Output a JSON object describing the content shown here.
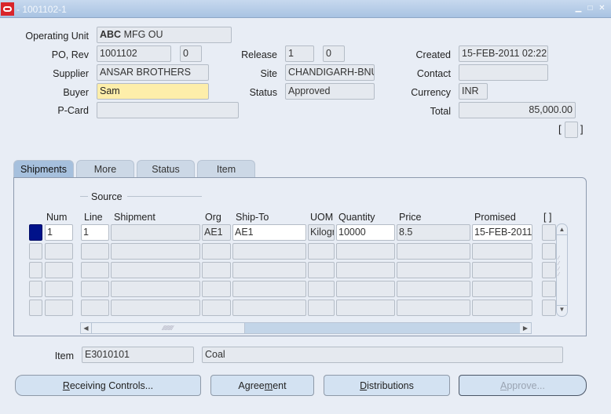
{
  "window": {
    "title": "- 1001102-1",
    "controls": {
      "minimize": "▁",
      "maximize": "□",
      "close": "✕"
    }
  },
  "header": {
    "operating_unit": {
      "label": "Operating Unit",
      "value_bold": "ABC",
      "value_rest": " MFG OU"
    },
    "po_rev": {
      "label": "PO, Rev",
      "po": "1001102",
      "rev": "0"
    },
    "supplier": {
      "label": "Supplier",
      "value": "ANSAR BROTHERS"
    },
    "buyer": {
      "label": "Buyer",
      "value": "Sam"
    },
    "pcard": {
      "label": "P-Card",
      "value": ""
    },
    "release": {
      "label": "Release",
      "num": "1",
      "rev": "0"
    },
    "site": {
      "label": "Site",
      "value": "CHANDIGARH-BNU"
    },
    "status": {
      "label": "Status",
      "value": "Approved"
    },
    "created": {
      "label": "Created",
      "value": "15-FEB-2011 02:22"
    },
    "contact": {
      "label": "Contact",
      "value": ""
    },
    "currency": {
      "label": "Currency",
      "value": "INR"
    },
    "total": {
      "label": "Total",
      "value": "85,000.00"
    },
    "dff": {
      "open": "[",
      "close": "]"
    }
  },
  "tabs": [
    {
      "label": "Shipments",
      "active": true
    },
    {
      "label": "More",
      "active": false
    },
    {
      "label": "Status",
      "active": false
    },
    {
      "label": "Item",
      "active": false
    }
  ],
  "grid": {
    "group_label": "Source",
    "columns": [
      "Num",
      "Line",
      "Shipment",
      "Org",
      "Ship-To",
      "UOM",
      "Quantity",
      "Price",
      "Promised",
      "[ ]"
    ],
    "rows": [
      {
        "num": "1",
        "line": "1",
        "shipment": "",
        "org": "AE1",
        "ship_to": "AE1",
        "uom": "Kilogram",
        "quantity": "10000",
        "price": "8.5",
        "promised": "15-FEB-2011"
      },
      {
        "num": "",
        "line": "",
        "shipment": "",
        "org": "",
        "ship_to": "",
        "uom": "",
        "quantity": "",
        "price": "",
        "promised": ""
      },
      {
        "num": "",
        "line": "",
        "shipment": "",
        "org": "",
        "ship_to": "",
        "uom": "",
        "quantity": "",
        "price": "",
        "promised": ""
      },
      {
        "num": "",
        "line": "",
        "shipment": "",
        "org": "",
        "ship_to": "",
        "uom": "",
        "quantity": "",
        "price": "",
        "promised": ""
      },
      {
        "num": "",
        "line": "",
        "shipment": "",
        "org": "",
        "ship_to": "",
        "uom": "",
        "quantity": "",
        "price": "",
        "promised": ""
      }
    ]
  },
  "item": {
    "label": "Item",
    "code": "E3010101",
    "description": "Coal"
  },
  "buttons": {
    "receiving_controls": {
      "mnemonic": "R",
      "rest": "eceiving Controls..."
    },
    "agreement": {
      "pre": "Agree",
      "mnemonic": "m",
      "rest": "ent"
    },
    "distributions": {
      "mnemonic": "D",
      "rest": "istributions"
    },
    "approve": {
      "mnemonic": "A",
      "rest": "pprove..."
    }
  },
  "colors": {
    "brand": "#d9252b",
    "current_row": "#00128a",
    "required_field": "#fdeeaa"
  }
}
